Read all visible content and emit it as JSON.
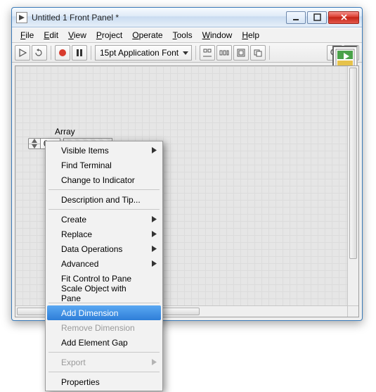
{
  "window": {
    "title": "Untitled 1 Front Panel *"
  },
  "menubar": {
    "items": [
      {
        "underline": "F",
        "rest": "ile"
      },
      {
        "underline": "E",
        "rest": "dit"
      },
      {
        "underline": "V",
        "rest": "iew"
      },
      {
        "underline": "P",
        "rest": "roject"
      },
      {
        "underline": "O",
        "rest": "perate"
      },
      {
        "underline": "T",
        "rest": "ools"
      },
      {
        "underline": "W",
        "rest": "indow"
      },
      {
        "underline": "H",
        "rest": "elp"
      }
    ]
  },
  "toolbar": {
    "font": "15pt Application Font"
  },
  "array": {
    "label": "Array",
    "index": "0"
  },
  "ctx": {
    "items": [
      {
        "label": "Visible Items",
        "submenu": true
      },
      {
        "label": "Find Terminal"
      },
      {
        "label": "Change to Indicator"
      },
      {
        "sep": true
      },
      {
        "label": "Description and Tip..."
      },
      {
        "sep": true
      },
      {
        "label": "Create",
        "submenu": true
      },
      {
        "label": "Replace",
        "submenu": true
      },
      {
        "label": "Data Operations",
        "submenu": true
      },
      {
        "label": "Advanced",
        "submenu": true
      },
      {
        "label": "Fit Control to Pane"
      },
      {
        "label": "Scale Object with Pane"
      },
      {
        "sep": true
      },
      {
        "label": "Add Dimension",
        "highlight": true
      },
      {
        "label": "Remove Dimension",
        "disabled": true
      },
      {
        "label": "Add Element Gap"
      },
      {
        "sep": true
      },
      {
        "label": "Export",
        "submenu": true,
        "disabled": true
      },
      {
        "sep": true
      },
      {
        "label": "Properties"
      }
    ]
  }
}
